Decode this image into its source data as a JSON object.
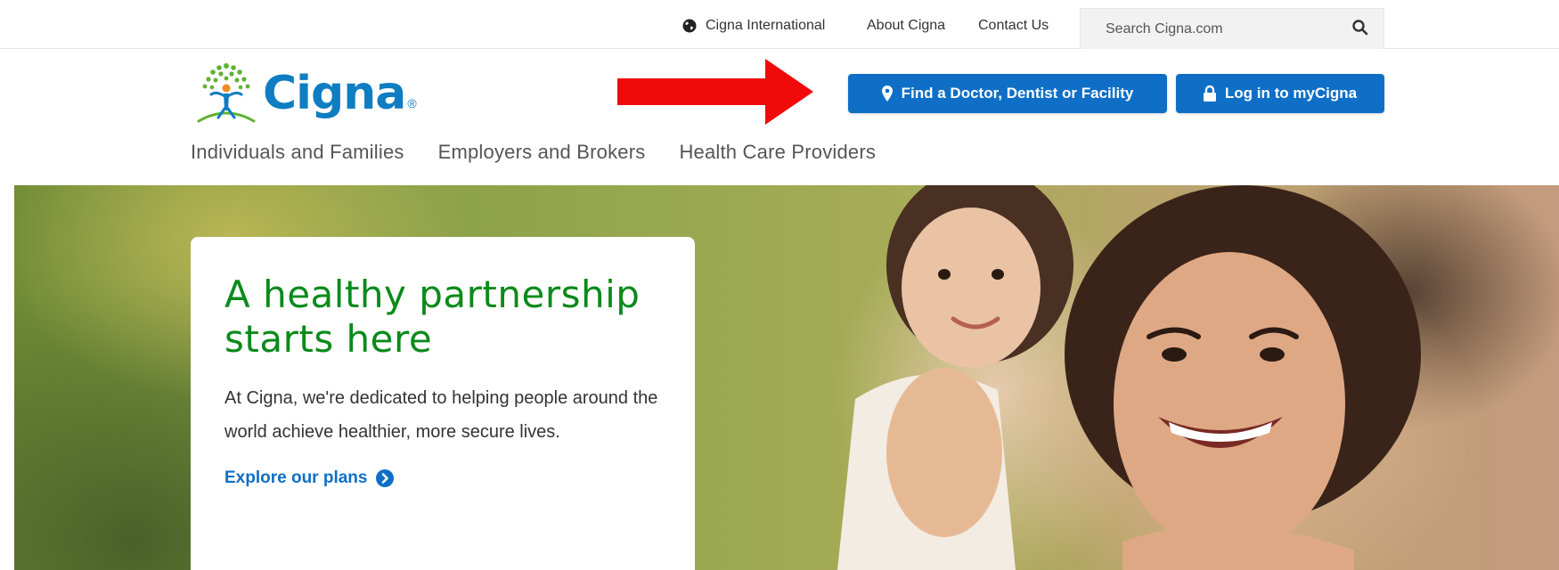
{
  "utility_bar": {
    "international_label": "Cigna International",
    "about_label": "About Cigna",
    "contact_label": "Contact Us",
    "search_placeholder": "Search Cigna.com"
  },
  "header": {
    "logo_text": "Cigna",
    "find_button_label": "Find a Doctor, Dentist or Facility",
    "login_button_label": "Log in to myCigna",
    "arrow_color": "#f10a0a"
  },
  "nav": {
    "items": [
      {
        "label": "Individuals and Families"
      },
      {
        "label": "Employers and Brokers"
      },
      {
        "label": "Health Care Providers"
      }
    ]
  },
  "hero": {
    "title": "A healthy partnership starts here",
    "body": "At Cigna, we're dedicated to helping people around the world achieve healthier, more secure lives.",
    "link_label": "Explore our plans"
  },
  "colors": {
    "brand_blue": "#0f6fc6",
    "logo_blue": "#0f7dc2",
    "hero_title_green": "#0b8a1b",
    "logo_tree_green": "#5fb233",
    "logo_tree_orange": "#f08a24"
  },
  "icons": {
    "globe": "globe-icon",
    "search": "search-icon",
    "map_pin": "map-pin-icon",
    "lock": "lock-icon",
    "chevron_right": "chevron-right-circle-icon"
  }
}
